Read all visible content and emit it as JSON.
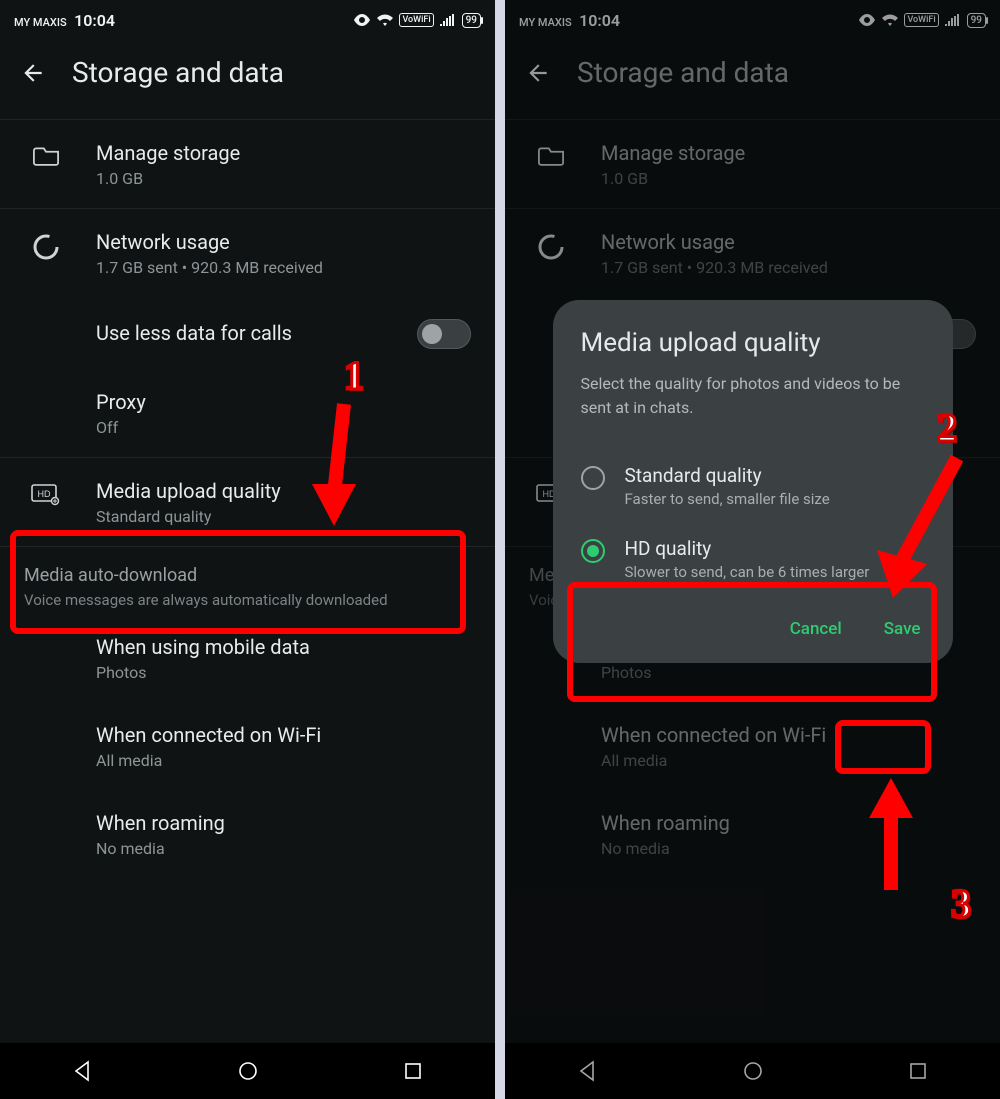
{
  "status": {
    "carrier": "MY MAXIS",
    "time": "10:04",
    "vowifi": "VoWiFi",
    "battery": "99"
  },
  "header": {
    "title": "Storage and data"
  },
  "items": {
    "manage_storage": {
      "title": "Manage storage",
      "sub": "1.0 GB"
    },
    "network_usage": {
      "title": "Network usage",
      "sub": "1.7 GB sent • 920.3 MB received"
    },
    "less_data": {
      "title": "Use less data for calls"
    },
    "proxy": {
      "title": "Proxy",
      "sub": "Off"
    },
    "media_upload": {
      "title": "Media upload quality",
      "sub": "Standard quality"
    }
  },
  "auto_dl": {
    "head": "Media auto-download",
    "sub": "Voice messages are always automatically downloaded",
    "mobile": {
      "title": "When using mobile data",
      "sub": "Photos"
    },
    "wifi": {
      "title": "When connected on Wi-Fi",
      "sub": "All media"
    },
    "roaming": {
      "title": "When roaming",
      "sub": "No media"
    }
  },
  "dialog": {
    "title": "Media upload quality",
    "desc": "Select the quality for photos and videos to be sent at in chats.",
    "opt_standard": {
      "title": "Standard quality",
      "sub": "Faster to send, smaller file size"
    },
    "opt_hd": {
      "title": "HD quality",
      "sub": "Slower to send, can be 6 times larger"
    },
    "cancel": "Cancel",
    "save": "Save"
  },
  "annot": {
    "n1": "1",
    "n2": "2",
    "n3": "3"
  }
}
